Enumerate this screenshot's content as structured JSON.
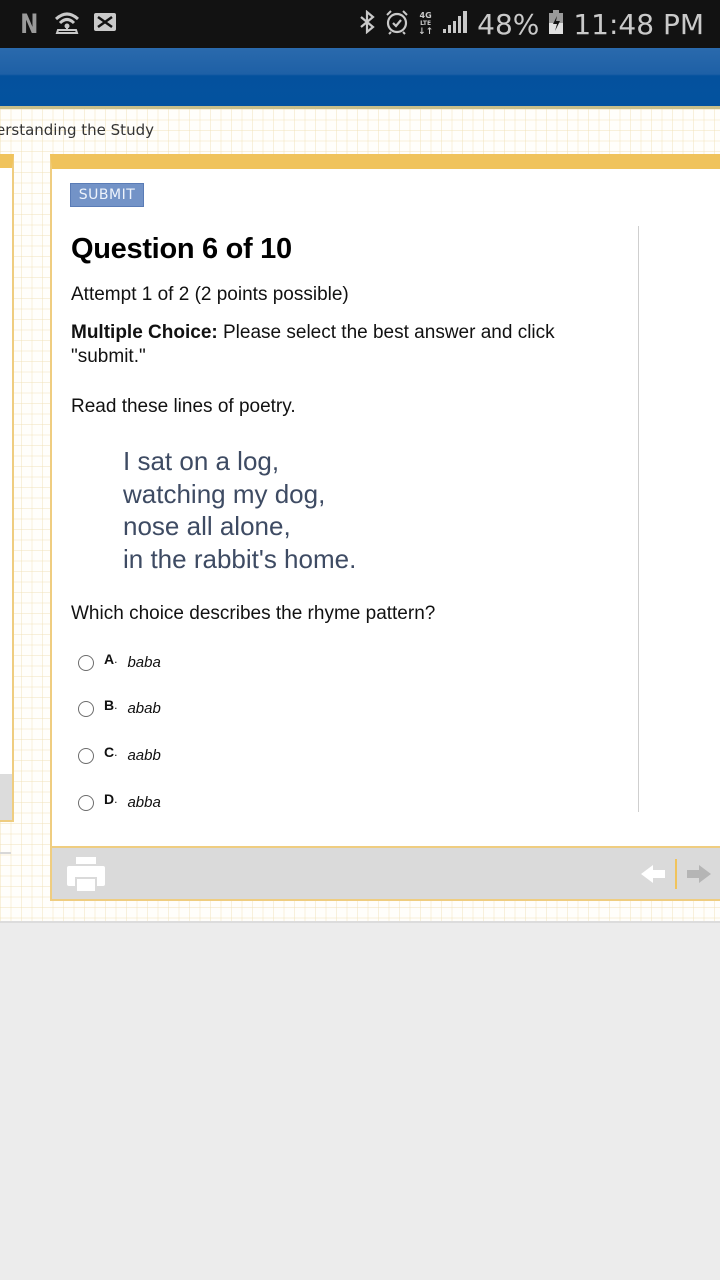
{
  "status_bar": {
    "left_icons": [
      "netflix-n-icon",
      "wifi-hotspot-icon",
      "mail-icon"
    ],
    "netflix_glyph": "N",
    "right_icons": [
      "bluetooth-icon",
      "alarm-icon",
      "4g-lte-icon",
      "signal-icon",
      "battery-charging-icon"
    ],
    "network_label_top": "4G",
    "network_label_bottom": "LTE",
    "network_arrows": "↓↑",
    "battery_percent": "48%",
    "time": "11:48 PM"
  },
  "breadcrumb": {
    "text": "erstanding the Study"
  },
  "toolbar": {
    "submit_label": "SUBMIT"
  },
  "question": {
    "title": "Question 6 of 10",
    "attempt": "Attempt 1 of 2 (2 points possible)",
    "instruction_bold": "Multiple Choice:",
    "instruction_text": " Please select the best answer and click \"submit.\"",
    "read_prompt": "Read these lines of poetry.",
    "poem_lines": [
      "I sat on a log,",
      "watching my dog,",
      "nose all alone,",
      "in the rabbit's home."
    ],
    "prompt": "Which choice describes the rhyme pattern?",
    "choices": [
      {
        "letter": "A",
        "dot": ".",
        "text": "baba",
        "selected": false
      },
      {
        "letter": "B",
        "dot": ".",
        "text": "abab",
        "selected": false
      },
      {
        "letter": "C",
        "dot": ".",
        "text": "aabb",
        "selected": false
      },
      {
        "letter": "D",
        "dot": ".",
        "text": "abba",
        "selected": false
      }
    ]
  },
  "footer": {
    "icons": [
      "print-icon",
      "previous-arrow-icon",
      "next-arrow-icon"
    ]
  },
  "colors": {
    "header_blue": "#04519d",
    "accent_gold": "#f0c35c",
    "submit_blue": "#7393c7",
    "poem_text": "#3e4b63",
    "footer_gray": "#dadada"
  }
}
